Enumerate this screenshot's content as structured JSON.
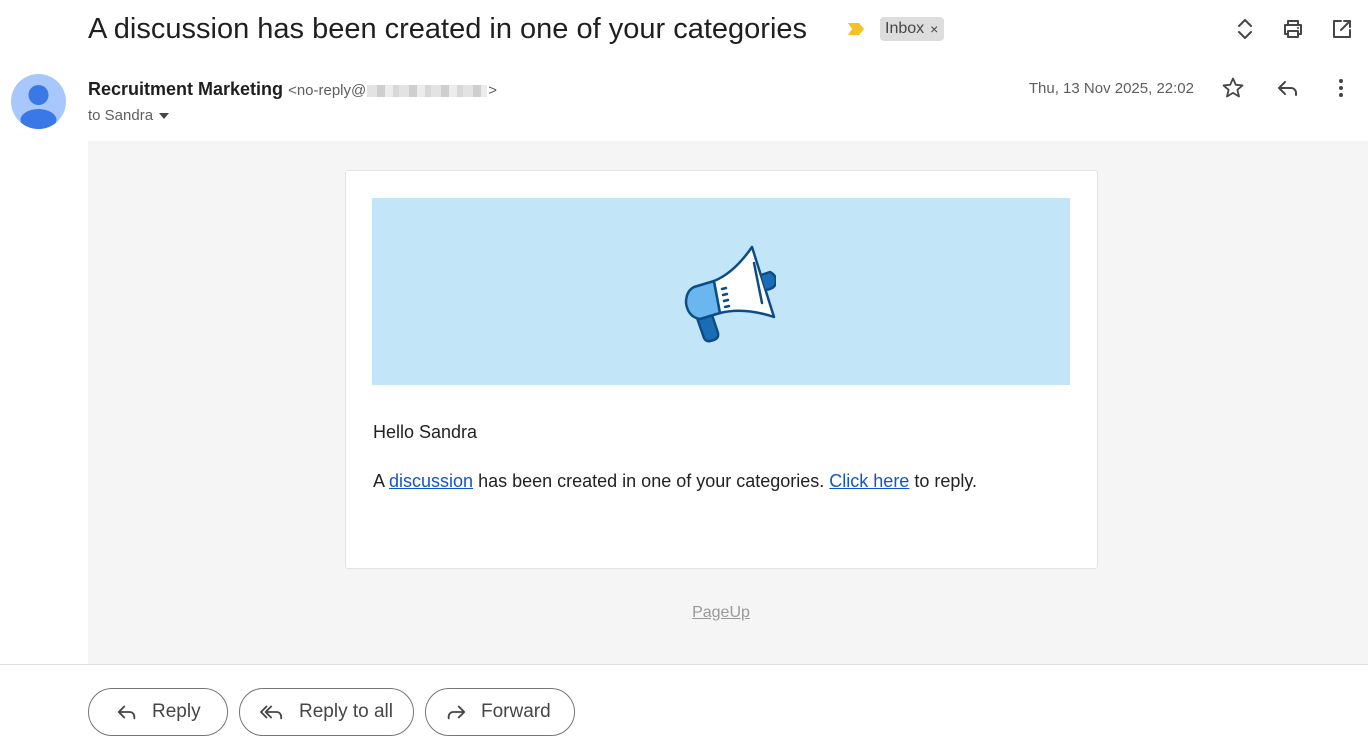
{
  "email": {
    "subject": "A discussion has been created in one of your categories",
    "label": "Inbox",
    "label_remove": "×",
    "sender_name": "Recruitment Marketing",
    "sender_addr_prefix": "<no-reply@",
    "sender_addr_suffix": ">",
    "to": "to Sandra",
    "date": "Thu, 13 Nov 2025, 22:02"
  },
  "content": {
    "greeting": "Hello Sandra",
    "message_part1": "A ",
    "link_discussion": "discussion",
    "message_part2": " has been created in one of your categories. ",
    "link_click_here": "Click here",
    "message_part3": " to reply.",
    "footer": "PageUp"
  },
  "actions": {
    "reply": "Reply",
    "reply_all": "Reply to all",
    "forward": "Forward"
  },
  "icons": {
    "importance": "importance-marker-icon",
    "expand": "expand-collapse-icon",
    "print": "print-icon",
    "popout": "open-in-new-window-icon",
    "star": "star-icon",
    "reply": "reply-icon",
    "more": "more-options-icon",
    "banner": "megaphone-icon"
  },
  "colors": {
    "importance": "#f6c026",
    "banner_bg": "#c2e5f7",
    "link": "#1155cc",
    "avatar_bg": "#a8c7fa",
    "avatar_fg": "#3b78e7"
  }
}
